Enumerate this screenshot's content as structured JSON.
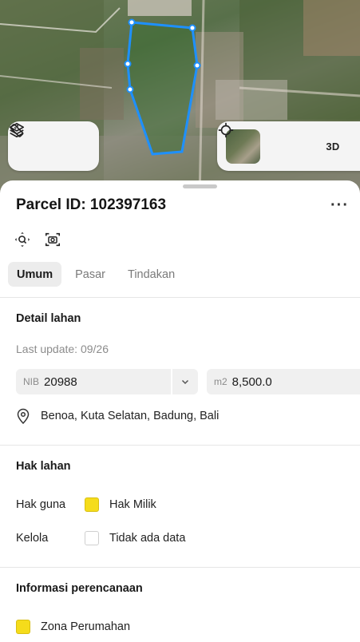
{
  "map": {
    "controls_left": [
      {
        "icon": "layers-icon"
      },
      {
        "icon": "measure-icon"
      }
    ],
    "controls_right": {
      "basemap_icon": "satellite-thumbnail",
      "locate_icon": "crosshair-icon",
      "mode_3d_label": "3D"
    },
    "colors": {
      "parcel_outline": "#1e90ff"
    }
  },
  "sheet": {
    "title": "Parcel ID: 102397163",
    "more_label": "···",
    "actions": [
      {
        "icon": "zoom-to-icon"
      },
      {
        "icon": "screenshot-icon"
      }
    ],
    "tabs": [
      {
        "label": "Umum",
        "active": true
      },
      {
        "label": "Pasar",
        "active": false
      },
      {
        "label": "Tindakan",
        "active": false
      }
    ],
    "detail": {
      "heading": "Detail lahan",
      "last_update": "Last update: 09/26",
      "nib_prefix": "NIB",
      "nib_value": "20988",
      "area_prefix": "m2",
      "area_value": "8,500.0",
      "location": "Benoa, Kuta Selatan, Badung, Bali"
    },
    "rights": {
      "heading": "Hak lahan",
      "rows": [
        {
          "key": "Hak guna",
          "value": "Hak Milik",
          "color": "#f5dc1b"
        },
        {
          "key": "Kelola",
          "value": "Tidak ada data",
          "color": "#ffffff"
        }
      ]
    },
    "planning": {
      "heading": "Informasi perencanaan",
      "zone": "Zona Perumahan",
      "zone_color": "#f5dc1b"
    }
  }
}
